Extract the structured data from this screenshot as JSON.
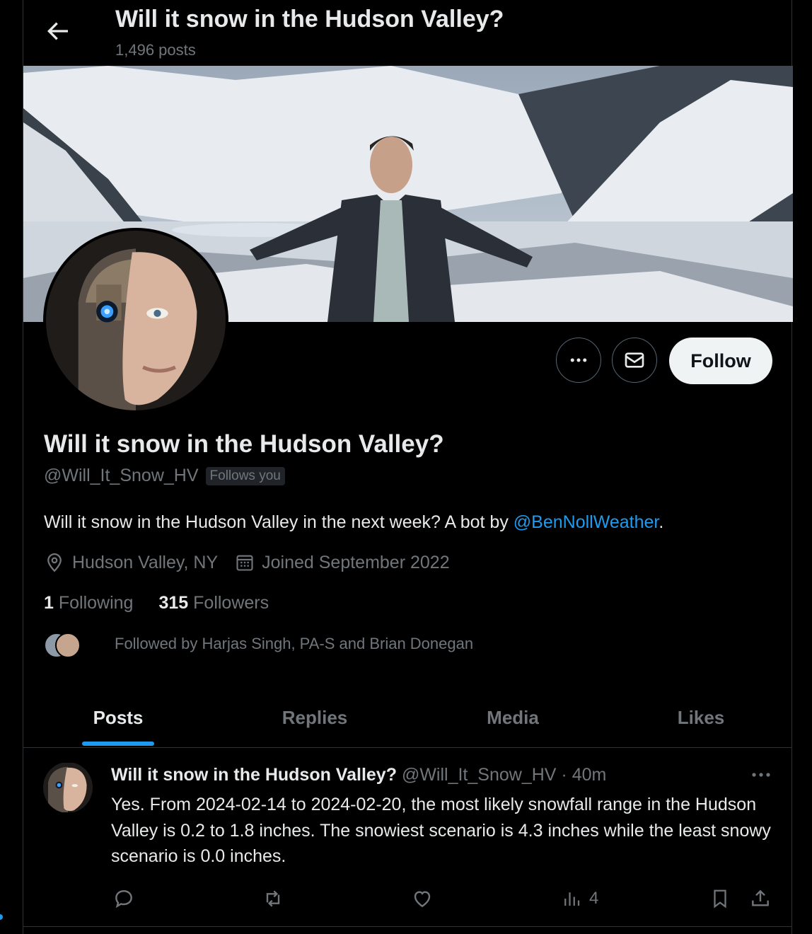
{
  "header": {
    "title": "Will it snow in the Hudson Valley?",
    "post_count": "1,496 posts"
  },
  "profile": {
    "name": "Will it snow in the Hudson Valley?",
    "handle": "@Will_It_Snow_HV",
    "follows_you": "Follows you",
    "bio_text": "Will it snow in the Hudson Valley in the next week? A bot by ",
    "bio_mention": "@BenNollWeather",
    "bio_end": ".",
    "location": "Hudson Valley, NY",
    "joined": "Joined September 2022",
    "following_count": "1",
    "following_label": "Following",
    "followers_count": "315",
    "followers_label": "Followers",
    "followed_by": "Followed by Harjas Singh, PA-S and Brian Donegan",
    "follow_button": "Follow"
  },
  "tabs": [
    {
      "label": "Posts",
      "active": true
    },
    {
      "label": "Replies",
      "active": false
    },
    {
      "label": "Media",
      "active": false
    },
    {
      "label": "Likes",
      "active": false
    }
  ],
  "post": {
    "name": "Will it snow in the Hudson Valley?",
    "handle": "@Will_It_Snow_HV",
    "separator": "·",
    "time": "40m",
    "text": "Yes. From 2024-02-14 to 2024-02-20, the most likely snowfall range in the Hudson Valley is 0.2 to 1.8 inches. The snowiest scenario is 4.3 inches while the least snowy scenario is 0.0 inches.",
    "views": "4"
  },
  "icons": {
    "back": "arrow-left-icon",
    "more": "more-icon",
    "message": "envelope-icon",
    "location": "location-pin-icon",
    "calendar": "calendar-icon",
    "reply": "reply-icon",
    "repost": "repost-icon",
    "like": "heart-icon",
    "views": "views-icon",
    "bookmark": "bookmark-icon",
    "share": "share-icon"
  },
  "colors": {
    "background": "#000000",
    "accent": "#1d9bf0",
    "text": "#e7e9ea",
    "muted": "#71767b",
    "border": "#2f3336"
  }
}
